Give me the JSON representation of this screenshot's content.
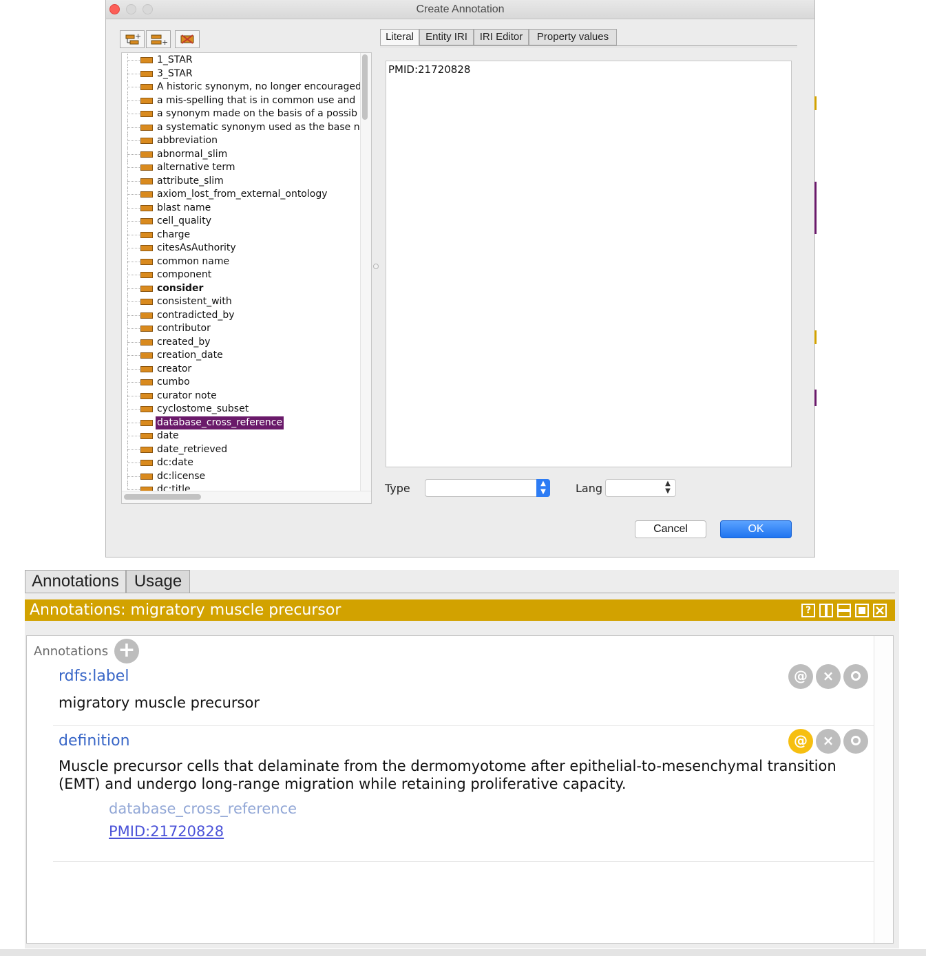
{
  "dialog": {
    "title": "Create Annotation",
    "tabs": [
      "Literal",
      "Entity IRI",
      "IRI Editor",
      "Property values"
    ],
    "active_tab": "Literal",
    "literal_value": "PMID:21720828",
    "type_label": "Type",
    "type_value": "",
    "lang_label": "Lang",
    "lang_value": "",
    "cancel_label": "Cancel",
    "ok_label": "OK",
    "toolbar_icons": [
      "add-sub-property-icon",
      "add-sibling-property-icon",
      "delete-property-icon"
    ],
    "property_icon": "annotation-property-icon",
    "accent_color": "#6a1a6a",
    "tree_items": [
      "1_STAR",
      "3_STAR",
      "A historic synonym, no longer encouraged",
      "a mis-spelling that is in common use and",
      "a synonym made on the basis of a possib",
      "a systematic synonym used as the base na",
      "abbreviation",
      "abnormal_slim",
      "alternative term",
      "attribute_slim",
      "axiom_lost_from_external_ontology",
      "blast name",
      "cell_quality",
      "charge",
      "citesAsAuthority",
      "common name",
      "component",
      "consider",
      "consistent_with",
      "contradicted_by",
      "contributor",
      "created_by",
      "creation_date",
      "creator",
      "cumbo",
      "curator note",
      "cyclostome_subset",
      "database_cross_reference",
      "date",
      "date_retrieved",
      "dc:date",
      "dc:license",
      "dc:title"
    ],
    "bold_item": "consider",
    "selected_item": "database_cross_reference"
  },
  "panel": {
    "tabs": [
      "Annotations",
      "Usage"
    ],
    "active_tab": "Annotations",
    "header_title": "Annotations: migratory muscle precursor",
    "header_color": "#d2a200",
    "header_controls": [
      "?",
      "split-vertical-icon",
      "split-horizontal-icon",
      "maximize-icon",
      "close-icon"
    ],
    "section_label": "Annotations",
    "annotations": [
      {
        "property": "rdfs:label",
        "value": "migratory muscle precursor"
      },
      {
        "property": "definition",
        "value": "Muscle precursor cells that delaminate from the dermomyotome after epithelial-to-mesenchymal transition (EMT) and undergo long-range migration while retaining proliferative capacity.",
        "annotation_property": "database_cross_reference",
        "annotation_value": "PMID:21720828"
      }
    ],
    "row_buttons": [
      "@",
      "×",
      "o"
    ],
    "highlight_color": "#f6bf11"
  }
}
